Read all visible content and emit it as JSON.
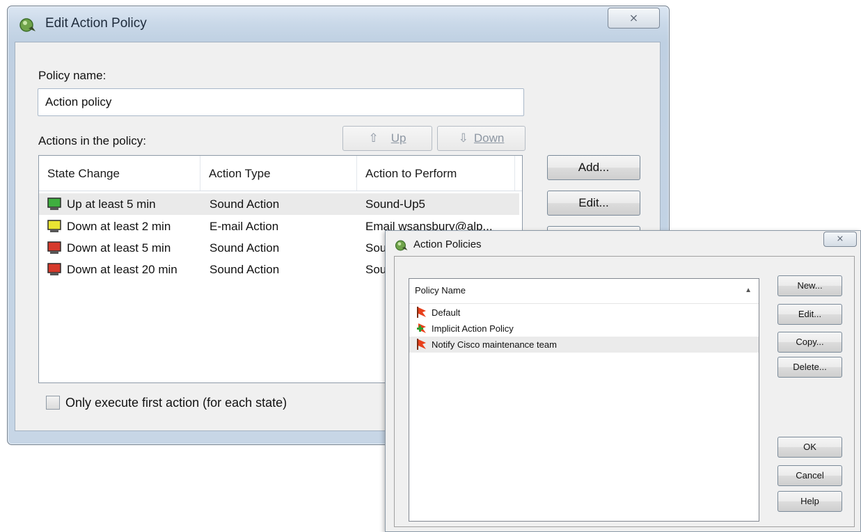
{
  "edit_dialog": {
    "title": "Edit Action Policy",
    "close_glyph": "⨯",
    "policy_name_label": "Policy name:",
    "policy_name_value": "Action policy",
    "actions_label": "Actions in the policy:",
    "up_label": "Up",
    "down_label": "Down",
    "up_icon": "up-arrow-icon",
    "down_icon": "down-arrow-icon",
    "columns": [
      "State Change",
      "Action Type",
      "Action to Perform"
    ],
    "rows": [
      {
        "state": "Up at least 5 min",
        "type": "Sound Action",
        "action": "Sound-Up5",
        "icon_color": "#3fae3f",
        "selected": true
      },
      {
        "state": "Down at least 2 min",
        "type": "E-mail Action",
        "action": "Email wsansbury@alp...",
        "icon_color": "#e9e433",
        "selected": false
      },
      {
        "state": "Down at least 5 min",
        "type": "Sound Action",
        "action": "Sou",
        "icon_color": "#d63a2c",
        "selected": false
      },
      {
        "state": "Down at least 20 min",
        "type": "Sound Action",
        "action": "Sou",
        "icon_color": "#d63a2c",
        "selected": false
      }
    ],
    "buttons": {
      "add": "Add...",
      "edit": "Edit..."
    },
    "first_action_checkbox": "Only execute first action (for each state)",
    "first_action_checked": false
  },
  "policies_dialog": {
    "title": "Action Policies",
    "close_glyph": "⨯",
    "column": "Policy Name",
    "policies": [
      {
        "name": "Default",
        "icon": "policy-flag-icon",
        "selected": false
      },
      {
        "name": "Implicit Action Policy",
        "icon": "policy-flag-plus-icon",
        "selected": false
      },
      {
        "name": "Notify Cisco maintenance team",
        "icon": "policy-flag-icon",
        "selected": true
      }
    ],
    "buttons": {
      "new": "New...",
      "edit": "Edit...",
      "copy": "Copy...",
      "delete": "Delete...",
      "ok": "OK",
      "cancel": "Cancel",
      "help": "Help"
    }
  },
  "colors": {
    "accent_flag": "#e8401c",
    "selection": "#eaeaea",
    "frame": "#c7d6e6"
  }
}
